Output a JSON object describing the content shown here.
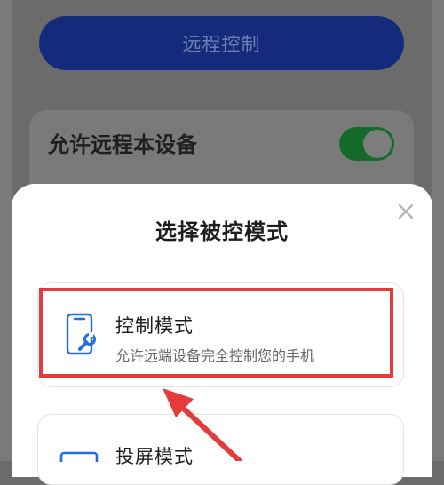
{
  "background": {
    "remote_control_button": "远程控制",
    "allow_remote_label": "允许远程本设备",
    "allow_toggle_on": true
  },
  "sheet": {
    "title": "选择被控模式",
    "options": [
      {
        "title": "控制模式",
        "desc": "允许远端设备完全控制您的手机",
        "icon": "phone-wrench-icon"
      },
      {
        "title": "投屏模式",
        "icon": "screen-cast-icon"
      }
    ]
  },
  "colors": {
    "primary": "#132b7a",
    "toggle_on": "#146b2a",
    "highlight": "#e53b3b",
    "icon_blue": "#1f6fe0"
  }
}
